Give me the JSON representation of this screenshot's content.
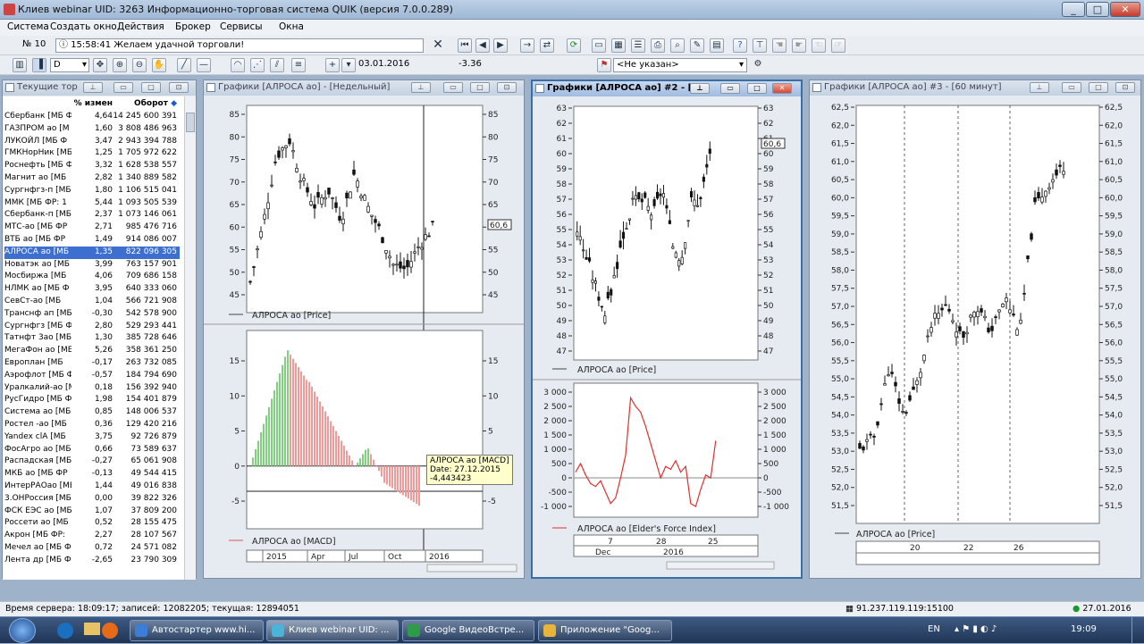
{
  "window": {
    "title": "Клиев webinar UID: 3263 Информационно-торговая система QUIK (версия 7.0.0.289)"
  },
  "menu": [
    "Система",
    "Создать окно",
    "Действия",
    "Брокер",
    "Сервисы",
    "Окна"
  ],
  "toolbar1": {
    "id_box": "№ 10",
    "message": "15:58:41 Желаем удачной торговли!"
  },
  "toolbar2": {
    "interval": "D",
    "date": "03.01.2016",
    "value": "-3.36",
    "account": "<Не указан>"
  },
  "table": {
    "title": "Текущие тор",
    "col2": "% измен",
    "col3": "Оборот",
    "rows": [
      [
        "Сбербанк [МБ ФР",
        "4,64",
        "14 245 600 391"
      ],
      [
        "ГАЗПРОМ ао [М",
        "1,60",
        "3 808 486 963"
      ],
      [
        "ЛУКОЙЛ [МБ Ф",
        "3,47",
        "2 943 394 788"
      ],
      [
        "ГМКНорНик [МБ",
        "1,25",
        "1 705 972 622"
      ],
      [
        "Роснефть [МБ Ф",
        "3,32",
        "1 628 538 557"
      ],
      [
        "Магнит ао [МБ",
        "2,82",
        "1 340 889 582"
      ],
      [
        "Сургнфгз-п [МБ",
        "1,80",
        "1 106 515 041"
      ],
      [
        "ММК [МБ ФР: 1",
        "5,44",
        "1 093 505 539"
      ],
      [
        "Сбербанк-п [МБ",
        "2,37",
        "1 073 146 061"
      ],
      [
        "МТС-ао [МБ ФР",
        "2,71",
        "985 476 716"
      ],
      [
        "ВТБ ао [МБ ФР",
        "1,49",
        "914 086 007"
      ],
      [
        "АЛРОСА ао [МБ",
        "1,35",
        "822 096 305"
      ],
      [
        "Новатэк ао [МБ",
        "3,99",
        "763 157 901"
      ],
      [
        "Мосбиржа [МБ",
        "4,06",
        "709 686 158"
      ],
      [
        "НЛМК ао [МБ Ф",
        "3,95",
        "640 333 060"
      ],
      [
        "СевСт-ао [МБ",
        "1,04",
        "566 721 908"
      ],
      [
        "Транснф ап [МБ",
        "-0,30",
        "542 578 900"
      ],
      [
        "Сургнфгз [МБ Ф",
        "2,80",
        "529 293 441"
      ],
      [
        "Татнфт 3ао [МБ",
        "1,30",
        "385 728 646"
      ],
      [
        "МегаФон ао [МБ",
        "5,26",
        "358 361 250"
      ],
      [
        "Европлан [МБ",
        "-0,17",
        "263 732 085"
      ],
      [
        "Аэрофлот [МБ Ф",
        "-0,57",
        "184 794 690"
      ],
      [
        "Уралкалий-ао [М",
        "0,18",
        "156 392 940"
      ],
      [
        "РусГидро [МБ Ф",
        "1,98",
        "154 401 879"
      ],
      [
        "Система ао [МБ",
        "0,85",
        "148 006 537"
      ],
      [
        "Ростел -ао [МБ",
        "0,36",
        "129 420 216"
      ],
      [
        "Yandex clA [МБ",
        "3,75",
        "92 726 879"
      ],
      [
        "ФосАгро ао [МБ",
        "0,66",
        "73 589 637"
      ],
      [
        "Распадская [МБ",
        "-0,27",
        "65 061 908"
      ],
      [
        "МКБ ао [МБ ФР",
        "-0,13",
        "49 544 415"
      ],
      [
        "ИнтерРАОао [МБ",
        "1,44",
        "49 016 838"
      ],
      [
        "3.ОНРоссия [МБ",
        "0,00",
        "39 822 326"
      ],
      [
        "ФСК ЕЭС ао [МБ",
        "1,07",
        "37 809 200"
      ],
      [
        "Россети ао [МБ",
        "0,52",
        "28 155 475"
      ],
      [
        "Акрон [МБ ФР:",
        "2,27",
        "28 107 567"
      ],
      [
        "Мечел ао [МБ Ф",
        "0,72",
        "24 571 082"
      ],
      [
        "Лента др [МБ Ф",
        "-2,65",
        "23 790 309"
      ]
    ],
    "selected_index": 11
  },
  "chart1": {
    "title": "Графики [АЛРОСА ао] - [Недельный]",
    "price_legend": "АЛРОСА ао [Price]",
    "macd_legend": "АЛРОСА ао [MACD]",
    "price_ticks": [
      "85",
      "80",
      "75",
      "70",
      "65",
      "60",
      "55",
      "50",
      "45"
    ],
    "last_price": "60,6",
    "macd_ticks": [
      "15",
      "10",
      "5",
      "0",
      "-5"
    ],
    "xlabels": [
      "2015",
      "Apr",
      "Jul",
      "Oct",
      "2016"
    ],
    "tooltip": "АЛРОСА ао [MACD]\nDate: 27.12.2015\n-4,443423"
  },
  "chart2": {
    "title": "Графики [АЛРОСА ао] #2 - [Д",
    "price_legend": "АЛРОСА ао [Price]",
    "force_legend": "АЛРОСА ао [Elder's Force Index]",
    "price_ticks": [
      "63",
      "62",
      "61",
      "60",
      "59",
      "58",
      "57",
      "56",
      "55",
      "54",
      "53",
      "52",
      "51",
      "50",
      "49",
      "48",
      "47"
    ],
    "last_price": "60,6",
    "force_ticks": [
      "3 000",
      "2 500",
      "2 000",
      "1 500",
      "1 000",
      "500",
      "0",
      "-500",
      "-1 000"
    ],
    "xlabels_top": [
      "7",
      "28",
      "25"
    ],
    "xlabels_bottom": [
      "Dec",
      "2016"
    ]
  },
  "chart3": {
    "title": "Графики [АЛРОСА ао] #3 - [60 минут]",
    "price_legend": "АЛРОСА ао [Price]",
    "price_ticks": [
      "62,5",
      "62,0",
      "61,5",
      "61,0",
      "60,5",
      "60,0",
      "59,5",
      "59,0",
      "58,5",
      "58,0",
      "57,5",
      "57,0",
      "56,5",
      "56,0",
      "55,5",
      "55,0",
      "54,5",
      "54,0",
      "53,5",
      "53,0",
      "52,5",
      "52,0",
      "51,5"
    ],
    "xlabels": [
      "20",
      "22",
      "26"
    ]
  },
  "status": {
    "server": "Время сервера: 18:09:17; записей: 12082205; текущая: 12894051",
    "ip": "91.237.119.119:15100",
    "date": "27.01.2016"
  },
  "taskbar": {
    "items": [
      "Автостартер www.hi...",
      "Клиев webinar UID: ...",
      "Google ВидеоВстре...",
      "Приложение \"Goog..."
    ],
    "lang": "EN",
    "clock": "19:09"
  }
}
